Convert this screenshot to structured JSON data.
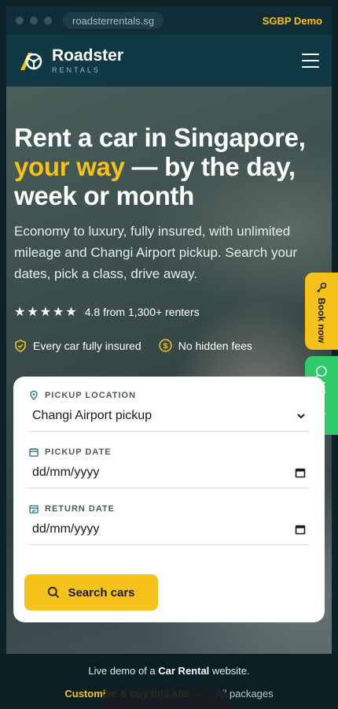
{
  "browser": {
    "url": "roadsterrentals.sg",
    "demo_tag": "SGBP Demo"
  },
  "header": {
    "brand_name": "Roadster",
    "brand_sub": "RENTALS",
    "menu_icon": "hamburger-icon"
  },
  "hero": {
    "title_part1": "Rent a car in Singapore,",
    "title_accent": "your way",
    "title_part2": " — by the day, week or month",
    "subtitle": "Economy to luxury, fully insured, with unlimited mileage and Changi Airport pickup. Search your dates, pick a class, drive away.",
    "stars": "★★★★★",
    "rating_text": "4.8 from 1,300+ renters",
    "perk1": "Every car fully insured",
    "perk2": "No hidden fees"
  },
  "side_tabs": {
    "book": "Book now",
    "whatsapp": "WhatsApp"
  },
  "search": {
    "pickup_location_label": "PICKUP LOCATION",
    "pickup_location_value": "Changi Airport pickup",
    "pickup_date_label": "PICKUP DATE",
    "pickup_date_value": "dd/mm/yyyy",
    "return_date_label": "RETURN DATE",
    "return_date_value": "dd/mm/yyyy",
    "button_label": "Search cars"
  },
  "footer": {
    "line_prefix": "Live demo of a ",
    "line_bold": "Car Rental",
    "line_suffix": " website.",
    "cta": "Customise & buy this site →",
    "all_packages": "All packages"
  },
  "colors": {
    "accent": "#f4c21b",
    "header_bg": "#0f3a45",
    "whatsapp": "#2fcb6a"
  }
}
